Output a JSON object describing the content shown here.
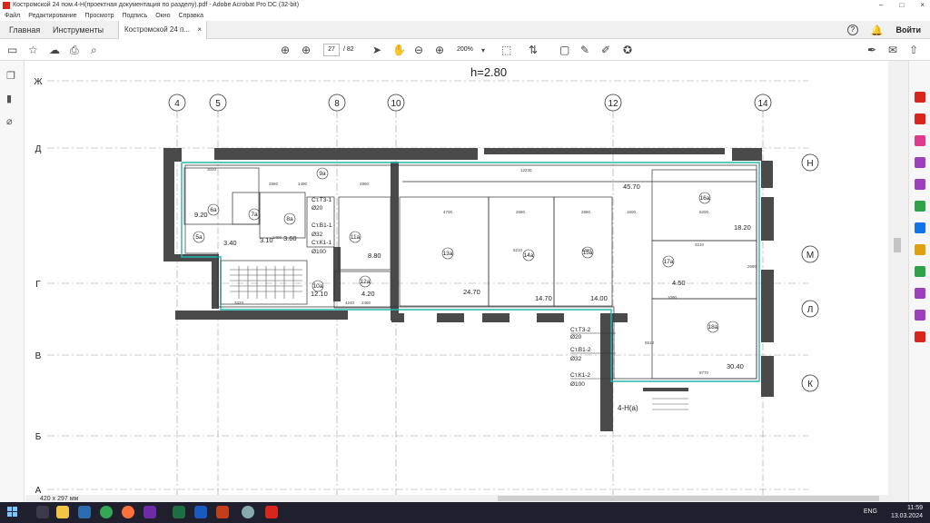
{
  "window": {
    "title": "Костромской 24 пом.4-Н(проектная документация по разделу).pdf - Adobe Acrobat Pro DC (32-bit)",
    "min": "–",
    "max": "□",
    "close": "×"
  },
  "menu": [
    "Файл",
    "Редактирование",
    "Просмотр",
    "Подпись",
    "Окно",
    "Справка"
  ],
  "tabs": {
    "home": "Главная",
    "tools": "Инструменты",
    "doc": "Костромской 24 п...",
    "doc_close": "×",
    "signin": "Войти",
    "help": "?"
  },
  "toolbar": {
    "page_current": "27",
    "page_total": "/ 82",
    "zoom": "200%"
  },
  "status": {
    "page_size": "420 x 297 мм"
  },
  "drawing": {
    "height_label": "h=2.80",
    "col_axes": [
      "4",
      "5",
      "8",
      "10",
      "12",
      "14"
    ],
    "row_axes_left": [
      "Ж",
      "Д",
      "Г",
      "В",
      "Б",
      "А"
    ],
    "row_axes_right": [
      "Н",
      "М",
      "Л",
      "К"
    ],
    "rooms": [
      "6а",
      "7а",
      "5а",
      "8а",
      "9а",
      "11а",
      "10а",
      "12а",
      "13а",
      "14а",
      "15а",
      "16а",
      "17а",
      "18а"
    ],
    "areas": [
      "9.20",
      "3.40",
      "3.10",
      "3.60",
      "8.80",
      "12.10",
      "4.20",
      "24.70",
      "14.70",
      "14.00",
      "45.70",
      "18.20",
      "4.50",
      "30.40"
    ],
    "risers": [
      "Ст.Т3-1",
      "Ø20",
      "Ст.В1-1",
      "Ø32",
      "Ст.К1-1",
      "Ø100",
      "Ст.Т3-2",
      "Ø20",
      "Ст.В1-2",
      "Ø32",
      "Ст.К1-2",
      "Ø100"
    ],
    "dims": [
      "3020",
      "2960",
      "1490",
      "2860",
      "12230",
      "4700",
      "2680",
      "2860",
      "1600",
      "6200",
      "3210",
      "1090",
      "4240",
      "2480",
      "3420",
      "9770",
      "5210",
      "5210",
      "2690",
      "1490",
      "5510"
    ],
    "unit_label": "4-Н(а)"
  },
  "taskbar": {
    "lang": "ENG",
    "time": "11:59",
    "date": "13.03.2024"
  },
  "colors": {
    "accent": "#1473e6",
    "adobe_red": "#d9261c",
    "wall": "#4a4a4a",
    "cyan": "#27b5b0"
  }
}
